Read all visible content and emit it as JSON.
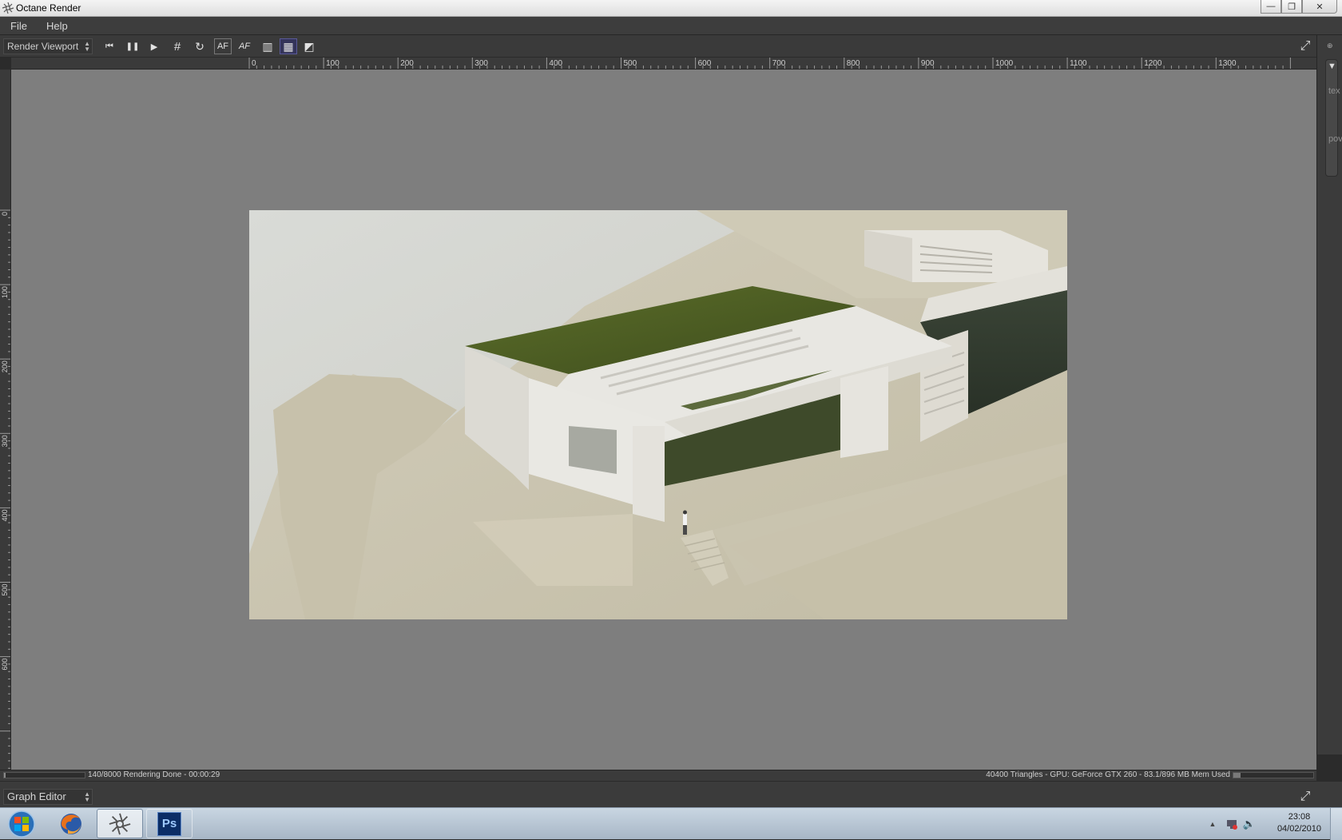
{
  "window": {
    "title": "Octane Render",
    "minimize_glyph": "—",
    "maximize_glyph": "❐",
    "close_glyph": "✕"
  },
  "menu": [
    "File",
    "Help"
  ],
  "toolbar": {
    "viewport_select": "Render Viewport",
    "buttons": [
      {
        "name": "restart-render-icon",
        "glyph": "⏮"
      },
      {
        "name": "pause-render-icon",
        "glyph": "❚❚"
      },
      {
        "name": "start-render-icon",
        "glyph": "▶"
      },
      {
        "name": "region-render-icon",
        "glyph": "#"
      },
      {
        "name": "refresh-icon",
        "glyph": "↻"
      },
      {
        "name": "autofocus-icon",
        "glyph": "AF"
      },
      {
        "name": "autofocus-picker-icon",
        "glyph": "AF"
      },
      {
        "name": "background-grey-icon",
        "glyph": "▥"
      },
      {
        "name": "background-checker-icon",
        "glyph": "▦"
      },
      {
        "name": "background-black-icon",
        "glyph": "◩"
      }
    ],
    "fullscreen_glyph": "⤢"
  },
  "side_panel": {
    "collapse_glyph": "▼",
    "labels": [
      "tex",
      "pov"
    ]
  },
  "rulers": {
    "horizontal_labels": [
      "0",
      "100",
      "200",
      "300",
      "400",
      "500",
      "600",
      "700",
      "800",
      "900",
      "1000",
      "1100",
      "1200",
      "1300"
    ],
    "vertical_labels": [
      "0",
      "100",
      "200",
      "300",
      "400",
      "500",
      "600"
    ]
  },
  "status": {
    "progress": 0.0175,
    "left_text": "140/8000 Rendering Done - 00:00:29",
    "right_text": "40400 Triangles - GPU: GeForce GTX 260 - 83.1/896 MB Mem Used",
    "mem_used_fraction": 0.093
  },
  "graph_editor": {
    "select": "Graph Editor",
    "fullscreen_glyph": "⤢"
  },
  "taskbar": {
    "apps": [
      {
        "name": "taskbar-firefox",
        "label": "Firefox"
      },
      {
        "name": "taskbar-octane",
        "label": "Octane Render"
      },
      {
        "name": "taskbar-photoshop",
        "label": "Ps"
      }
    ],
    "clock_time": "23:08",
    "clock_date": "04/02/2010"
  },
  "colors": {
    "viewport_bg": "#7e7e7e",
    "panel_bg": "#3b3b3b",
    "active_button": "#34345a",
    "taskbar": "#b7c5d3"
  }
}
